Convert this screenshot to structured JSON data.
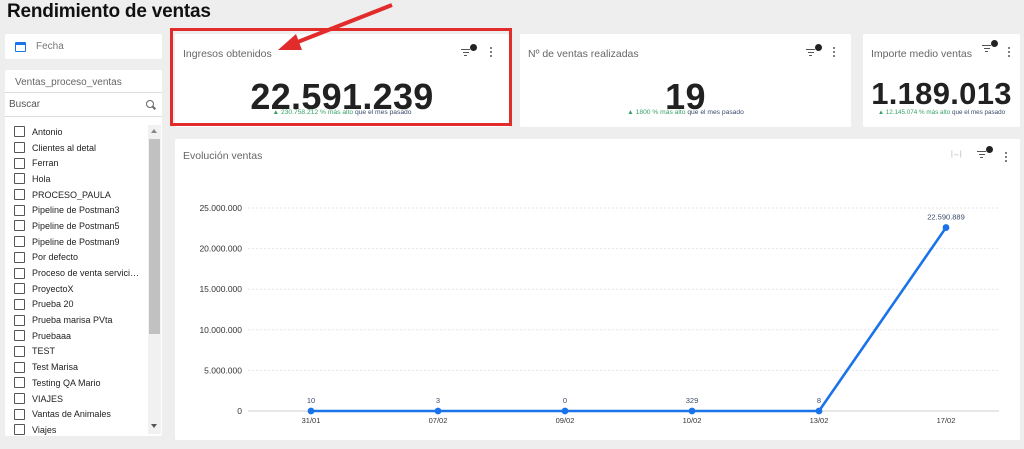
{
  "page": {
    "title": "Rendimiento de ventas"
  },
  "sidebar": {
    "date_label": "Fecha",
    "filter_title": "Ventas_proceso_ventas",
    "search_placeholder": "Buscar",
    "items": [
      "Antonio",
      "Clientes al detal",
      "Ferran",
      "Hola",
      "PROCESO_PAULA",
      "Pipeline de Postman3",
      "Pipeline de Postman5",
      "Pipeline de Postman9",
      "Por defecto",
      "Proceso de venta servicio…",
      "ProyectoX",
      "Prueba 20",
      "Prueba marisa PVta",
      "Pruebaaa",
      "TEST",
      "Test Marisa",
      "Testing QA Mario",
      "VIAJES",
      "Vantas de Animales",
      "Viajes"
    ]
  },
  "kpis": [
    {
      "title": "Ingresos obtenidos",
      "value": "22.591.239",
      "delta": "▲ 230.758.212 % más alto",
      "compare": "que el mes pasado"
    },
    {
      "title": "Nº de ventas realizadas",
      "value": "19",
      "delta": "▲ 1800 % más alto",
      "compare": "que el mes pasado"
    },
    {
      "title": "Importe medio ventas",
      "value": "1.189.013",
      "delta": "▲ 12.145.074 % más alto",
      "compare": "que el mes pasado"
    }
  ],
  "colors": {
    "accent": "#1a73e8",
    "positive": "#38a169",
    "highlight": "#e22b2b"
  },
  "chart_data": {
    "type": "line",
    "title": "Evolución ventas",
    "xlabel": "",
    "ylabel": "",
    "categories": [
      "31/01",
      "07/02",
      "09/02",
      "10/02",
      "13/02",
      "17/02"
    ],
    "series": [
      {
        "values": [
          10,
          3,
          0,
          329,
          8,
          22590889
        ],
        "labels": [
          "10",
          "3",
          "0",
          "329",
          "8",
          "22.590.889"
        ]
      }
    ],
    "ylim": [
      0,
      25000000
    ],
    "yticks": [
      0,
      5000000,
      10000000,
      15000000,
      20000000,
      25000000
    ],
    "ytick_labels": [
      "0",
      "5.000.000",
      "10.000.000",
      "15.000.000",
      "20.000.000",
      "25.000.000"
    ],
    "grid": true,
    "legend": "none",
    "color": "#1a73e8"
  }
}
